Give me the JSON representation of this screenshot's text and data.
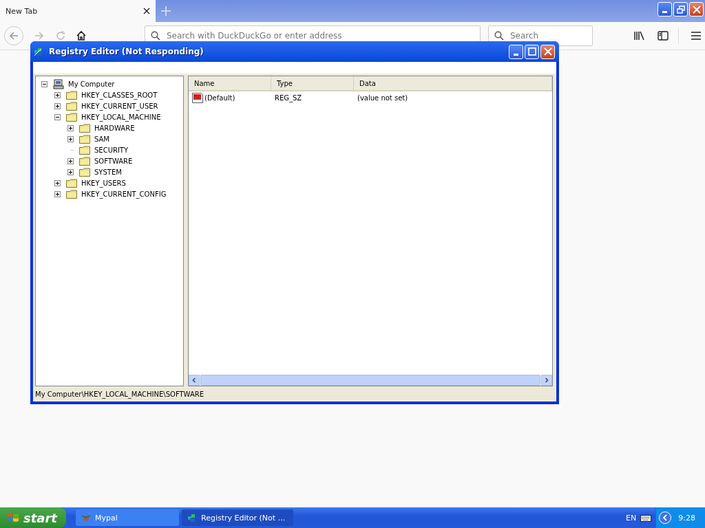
{
  "browser": {
    "tabs": [
      {
        "label": "New Tab",
        "selected": true
      }
    ],
    "address": {
      "placeholder": "Search with DuckDuckGo or enter address"
    },
    "search": {
      "placeholder": "Search"
    },
    "forward_disabled": true
  },
  "regedit": {
    "title": "Registry Editor (Not Responding)",
    "tree": [
      {
        "label": "My Computer",
        "kind": "computer",
        "expanded": true,
        "children": [
          {
            "label": "HKEY_CLASSES_ROOT",
            "kind": "folder",
            "expanded": false
          },
          {
            "label": "HKEY_CURRENT_USER",
            "kind": "folder",
            "expanded": false
          },
          {
            "label": "HKEY_LOCAL_MACHINE",
            "kind": "folder",
            "expanded": true,
            "children": [
              {
                "label": "HARDWARE",
                "kind": "folder",
                "expanded": false
              },
              {
                "label": "SAM",
                "kind": "folder",
                "expanded": false
              },
              {
                "label": "SECURITY",
                "kind": "empty_folder"
              },
              {
                "label": "SOFTWARE",
                "kind": "folder",
                "expanded": false
              },
              {
                "label": "SYSTEM",
                "kind": "folder",
                "expanded": false
              }
            ]
          },
          {
            "label": "HKEY_USERS",
            "kind": "folder",
            "expanded": false
          },
          {
            "label": "HKEY_CURRENT_CONFIG",
            "kind": "folder",
            "expanded": false
          }
        ]
      }
    ],
    "columns": [
      "Name",
      "Type",
      "Data"
    ],
    "rows": [
      {
        "name": "(Default)",
        "type": "REG_SZ",
        "data": "(value not set)"
      }
    ],
    "status_bar": "My Computer\\HKEY_LOCAL_MACHINE\\SOFTWARE"
  },
  "taskbar": {
    "start": "start",
    "tasks": [
      {
        "label": "Mypal",
        "selected": false
      },
      {
        "label": "Registry Editor (Not ...",
        "selected": true
      }
    ],
    "language": "EN",
    "clock": "9:28"
  }
}
